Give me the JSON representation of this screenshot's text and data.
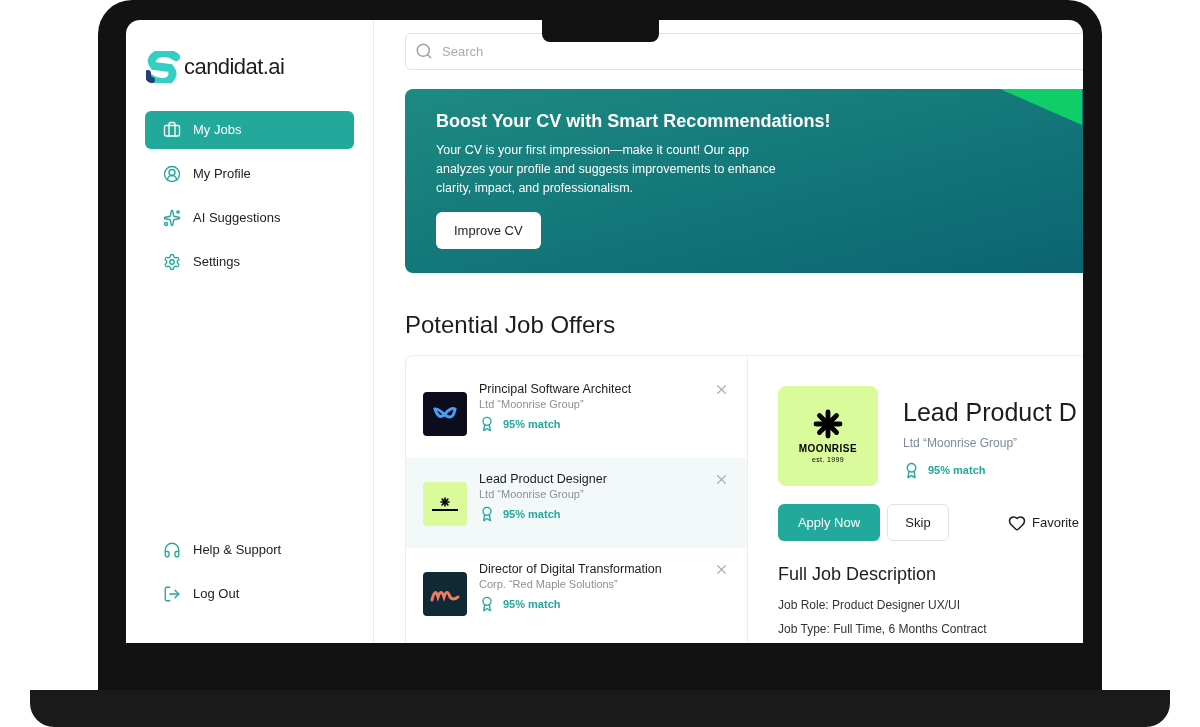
{
  "brand": {
    "name": "candidat.ai"
  },
  "sidebar": {
    "items": [
      {
        "label": "My Jobs",
        "kind": "briefcase",
        "selected": true
      },
      {
        "label": "My Profile",
        "kind": "user",
        "selected": false
      },
      {
        "label": "AI Suggestions",
        "kind": "sparkles",
        "selected": false
      },
      {
        "label": "Settings",
        "kind": "gear",
        "selected": false
      }
    ],
    "footer_items": [
      {
        "label": "Help & Support",
        "kind": "headphones"
      },
      {
        "label": "Log Out",
        "kind": "logout"
      }
    ]
  },
  "search": {
    "placeholder": "Search"
  },
  "banner": {
    "title": "Boost Your CV with Smart Recommendations!",
    "text": "Your CV is your first impression—make it count! Our app analyzes your profile and suggests improvements to enhance clarity, impact, and professionalism.",
    "button": "Improve CV"
  },
  "section_title": "Potential Job Offers",
  "jobs": [
    {
      "title": "Principal Software Architect",
      "company": "Ltd “Moonrise Group”",
      "match": "95% match",
      "logo": {
        "kind": "wave"
      },
      "selected": false
    },
    {
      "title": "Lead Product Designer",
      "company": "Ltd “Moonrise Group”",
      "match": "95% match",
      "logo": {
        "kind": "moonrise"
      },
      "selected": true
    },
    {
      "title": "Director of Digital Transformation",
      "company": "Corp. “Red Maple Solutions”",
      "match": "95% match",
      "logo": {
        "kind": "script"
      },
      "selected": false
    }
  ],
  "detail": {
    "title": "Lead Product D",
    "company": "Ltd “Moonrise Group”",
    "match": "95% match",
    "logo": {
      "kind": "moonrise",
      "text": "MOONRISE",
      "subtext": "est. 1999"
    },
    "apply": "Apply Now",
    "skip": "Skip",
    "favorite": "Favorite",
    "description_title": "Full Job Description",
    "lines": [
      "Job Role: Product Designer UX/UI",
      "Job Type: Full Time, 6 Months Contract"
    ]
  }
}
